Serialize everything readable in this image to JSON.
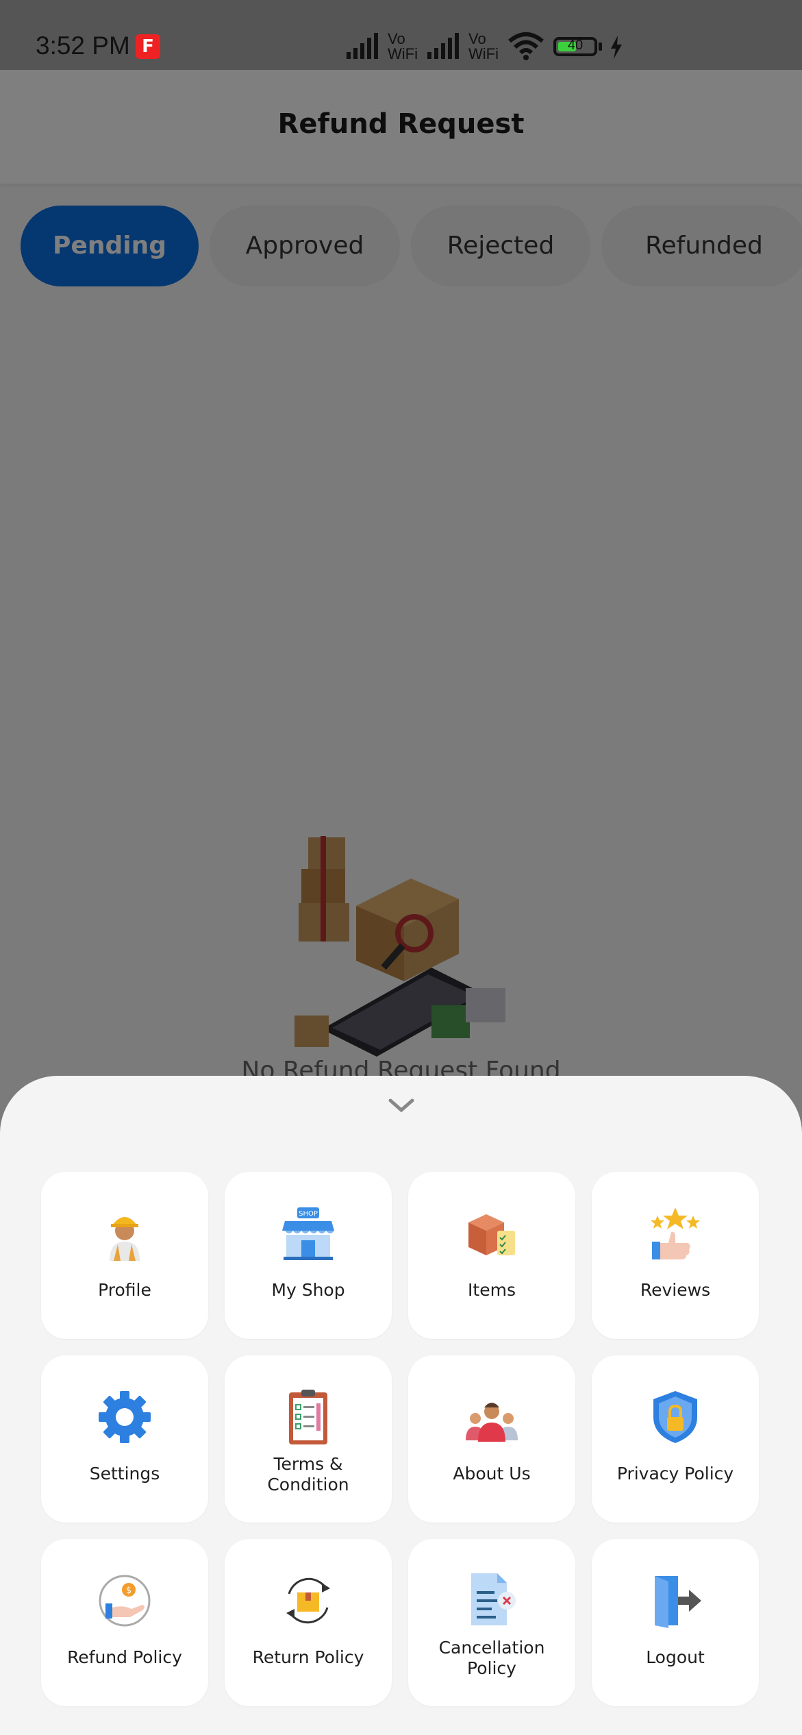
{
  "status_bar": {
    "time": "3:52 PM",
    "app_badge": "F",
    "sim1_label": "Vo WiFi",
    "sim2_label": "Vo WiFi",
    "battery_level": "40",
    "icons": [
      "signal-icon",
      "signal-icon",
      "wifi-icon",
      "battery-icon",
      "charging-icon"
    ]
  },
  "header": {
    "title": "Refund Request"
  },
  "tabs": [
    {
      "label": "Pending",
      "active": true
    },
    {
      "label": "Approved",
      "active": false
    },
    {
      "label": "Rejected",
      "active": false
    },
    {
      "label": "Refunded",
      "active": false
    }
  ],
  "empty_state": {
    "message": "No Refund Request Found"
  },
  "menu": {
    "items": [
      {
        "label": "Profile",
        "icon": "worker-avatar-icon"
      },
      {
        "label": "My Shop",
        "icon": "shop-icon"
      },
      {
        "label": "Items",
        "icon": "box-checklist-icon"
      },
      {
        "label": "Reviews",
        "icon": "stars-thumbs-up-icon"
      },
      {
        "label": "Settings",
        "icon": "gear-icon"
      },
      {
        "label": "Terms & Condition",
        "icon": "clipboard-icon"
      },
      {
        "label": "About Us",
        "icon": "people-icon"
      },
      {
        "label": "Privacy Policy",
        "icon": "shield-lock-icon"
      },
      {
        "label": "Refund Policy",
        "icon": "hand-coin-icon"
      },
      {
        "label": "Return Policy",
        "icon": "return-box-icon"
      },
      {
        "label": "Cancellation Policy",
        "icon": "cancel-document-icon"
      },
      {
        "label": "Logout",
        "icon": "logout-door-icon"
      }
    ]
  },
  "colors": {
    "accent": "#0b6fe0",
    "overlay": "rgba(0,0,0,0.5)",
    "sheet": "#f4f4f4"
  }
}
